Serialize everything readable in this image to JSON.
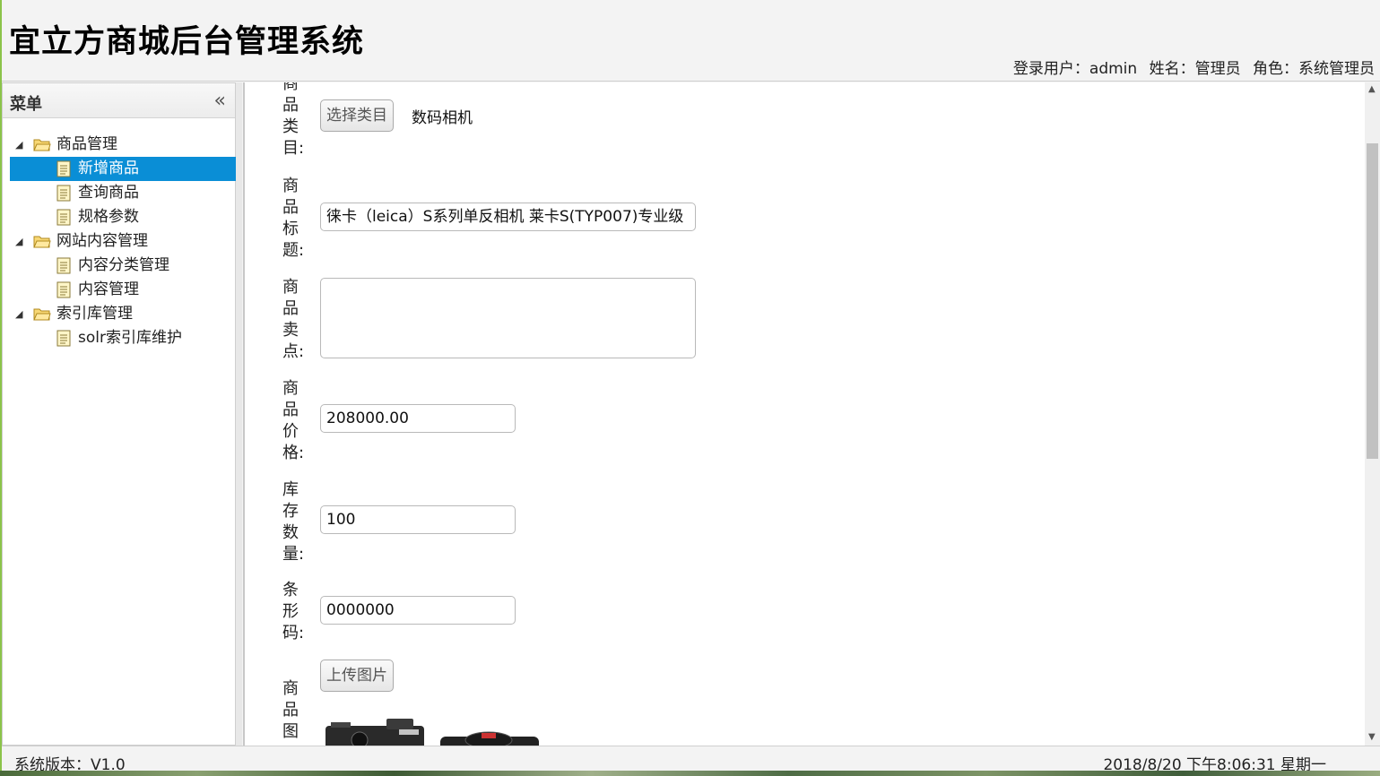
{
  "header": {
    "app_title": "宜立方商城后台管理系统",
    "login_user": "登录用户：admin",
    "name": "姓名：管理员",
    "role": "角色：系统管理员"
  },
  "sidebar": {
    "title": "菜单",
    "groups": [
      {
        "label": "商品管理",
        "items": [
          {
            "label": "新增商品",
            "selected": true
          },
          {
            "label": "查询商品"
          },
          {
            "label": "规格参数"
          }
        ]
      },
      {
        "label": "网站内容管理",
        "items": [
          {
            "label": "内容分类管理"
          },
          {
            "label": "内容管理"
          }
        ]
      },
      {
        "label": "索引库管理",
        "items": [
          {
            "label": "solr索引库维护"
          }
        ]
      }
    ]
  },
  "form": {
    "category": {
      "label": "商品类目:",
      "button": "选择类目",
      "value": "数码相机"
    },
    "title": {
      "label": "商品标题:",
      "value": "徕卡（leica）S系列单反相机 莱卡S(TYP007)专业级"
    },
    "sell_point": {
      "label": "商品卖点:",
      "value": ""
    },
    "price": {
      "label": "商品价格:",
      "value": "208000.00"
    },
    "stock": {
      "label": "库存数量:",
      "value": "100"
    },
    "barcode": {
      "label": "条形码:",
      "value": "0000000"
    },
    "image": {
      "label": "商品图",
      "button": "上传图片"
    }
  },
  "footer": {
    "version": "系统版本：V1.0",
    "clock": "2018/8/20 下午8:06:31 星期一"
  },
  "colors": {
    "selected_bg": "#0a8ed6",
    "left_edge": "#8bc34a"
  }
}
